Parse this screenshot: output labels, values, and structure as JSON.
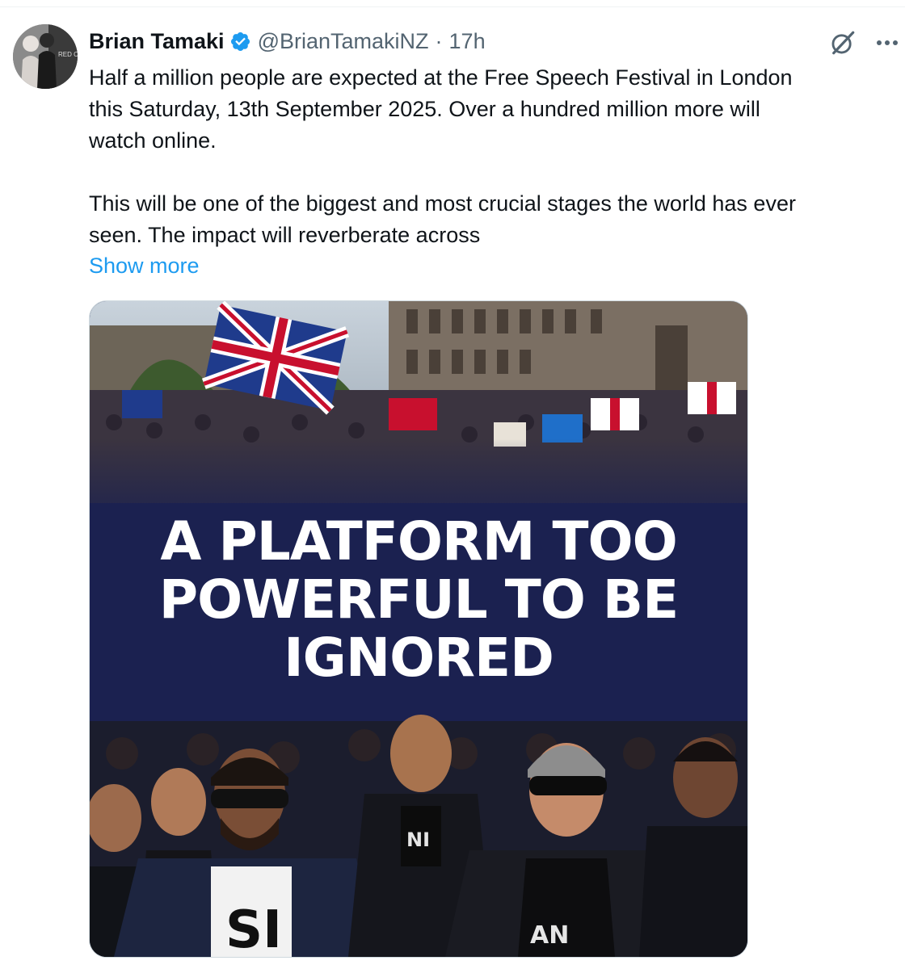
{
  "tweet": {
    "author": {
      "display_name": "Brian Tamaki",
      "handle": "@BrianTamakiNZ",
      "separator": "·",
      "time": "17h",
      "verified": true,
      "avatar_text": "RED CARPET"
    },
    "body": {
      "paragraph_1": "Half a million people are expected at the Free Speech Festival in London\nthis Saturday, 13th September 2025. Over a hundred million more will\nwatch online.",
      "paragraph_2": "This will be one of the biggest and most crucial stages the world has ever\nseen. The impact will reverberate across"
    },
    "show_more": "Show more",
    "actions": {
      "grok_icon": "grok-icon",
      "more_icon": "more-icon"
    },
    "media": {
      "headline_line_1": "A PLATFORM TOO",
      "headline_line_2": "POWERFUL TO BE",
      "headline_line_3": "IGNORED",
      "shirt_text_left": "SI",
      "shirt_text_right": "AN",
      "shirt_text_mid": "NI"
    }
  },
  "colors": {
    "accent": "#1d9bf0",
    "secondary_text": "#536471",
    "primary_text": "#0f1419",
    "media_navy": "#1b2150"
  }
}
